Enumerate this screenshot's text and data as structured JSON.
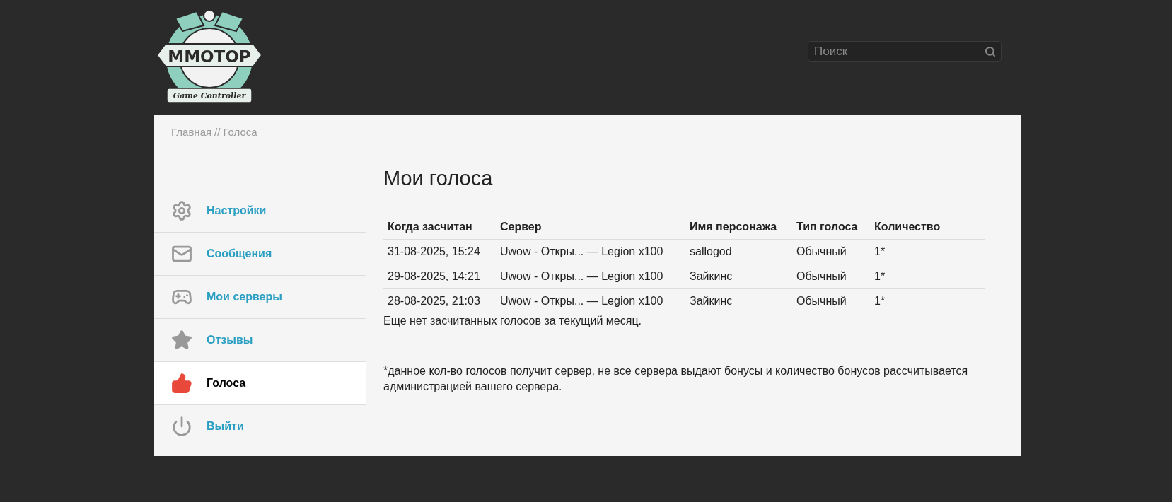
{
  "logo": {
    "title": "MMOTOP",
    "subtitle": "Game Controller"
  },
  "search": {
    "placeholder": "Поиск"
  },
  "breadcrumb": [
    "Главная",
    "//",
    "Голоса"
  ],
  "sidebar": {
    "items": [
      {
        "label": "Настройки",
        "selected": false
      },
      {
        "label": "Сообщения",
        "selected": false
      },
      {
        "label": "Мои серверы",
        "selected": false
      },
      {
        "label": "Отзывы",
        "selected": false
      },
      {
        "label": "Голоса",
        "selected": true
      },
      {
        "label": "Выйти",
        "selected": false
      }
    ]
  },
  "page_title": "Мои голоса",
  "table": {
    "columns": [
      "Когда засчитан",
      "Сервер",
      "Имя персонажа",
      "Тип голоса",
      "Количество"
    ],
    "rows": [
      [
        "31-08-2025, 15:24",
        "Uwow - Откры... — Legion x100",
        "sallogod",
        "Обычный",
        "1*"
      ],
      [
        "29-08-2025, 14:21",
        "Uwow - Откры... — Legion x100",
        "Зайкинс",
        "Обычный",
        "1*"
      ],
      [
        "28-08-2025, 21:03",
        "Uwow - Откры... — Legion x100",
        "Зайкинс",
        "Обычный",
        "1*"
      ]
    ]
  },
  "empty_message": "Еще нет засчитанных голосов за текущий месяц.",
  "footnote": "*данное кол-во голосов получит сервер, не все сервера выдают бонусы и количество бонусов рассчитывается администрацией вашего сервера."
}
